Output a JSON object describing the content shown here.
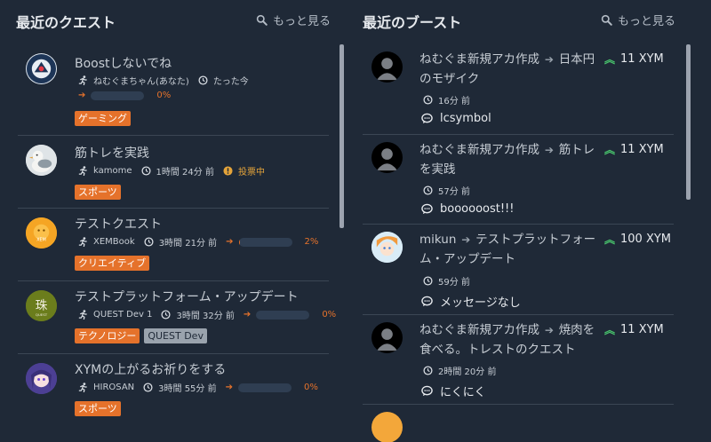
{
  "quests": {
    "title": "最近のクエスト",
    "more_label": "もっと見る",
    "items": [
      {
        "title": "Boostしないでね",
        "author": "ねむぐまちゃん(あなた)",
        "time": "たった今",
        "status": "",
        "progress_label": "0%",
        "progress": 0,
        "tags": [
          "ゲーミング"
        ],
        "avatar": "boost-logo"
      },
      {
        "title": "筋トレを実践",
        "author": "kamome",
        "time": "1時間 24分 前",
        "status": "投票中",
        "progress_label": "",
        "progress": null,
        "tags": [
          "スポーツ"
        ],
        "avatar": "bird"
      },
      {
        "title": "テストクエスト",
        "author": "XEMBook",
        "time": "3時間 21分 前",
        "status": "",
        "progress_label": "2%",
        "progress": 2,
        "tags": [
          "クリエイティブ"
        ],
        "avatar": "xembook"
      },
      {
        "title": "テストプラットフォーム・アップデート",
        "author": "QUEST Dev 1",
        "time": "3時間 32分 前",
        "status": "",
        "progress_label": "0%",
        "progress": 0,
        "tags": [
          "テクノロジー",
          "QUEST Dev"
        ],
        "avatar": "quest-dev"
      },
      {
        "title": "XYMの上がるお祈りをする",
        "author": "HIROSAN",
        "time": "3時間 55分 前",
        "status": "",
        "progress_label": "0%",
        "progress": 0,
        "tags": [
          "スポーツ"
        ],
        "avatar": "anime-girl"
      }
    ]
  },
  "boosts": {
    "title": "最近のブースト",
    "more_label": "もっと見る",
    "items": [
      {
        "user": "ねむぐま新規アカ作成",
        "target": "日本円のモザイク",
        "amount": "11 XYM",
        "time": "16分 前",
        "message": "lcsymbol"
      },
      {
        "user": "ねむぐま新規アカ作成",
        "target": "筋トレを実践",
        "amount": "11 XYM",
        "time": "57分 前",
        "message": "boooooost!!!"
      },
      {
        "user": "mikun",
        "target": "テストプラットフォーム・アップデート",
        "amount": "100 XYM",
        "time": "59分 前",
        "message": "メッセージなし"
      },
      {
        "user": "ねむぐま新規アカ作成",
        "target": "焼肉を食べる。トレストのクエスト",
        "amount": "11 XYM",
        "time": "2時間 20分 前",
        "message": "にくにく"
      }
    ]
  },
  "colors": {
    "accent": "#e5722b",
    "boost_up": "#49c66d",
    "vote": "#e5a43a",
    "background": "#1f2937"
  }
}
